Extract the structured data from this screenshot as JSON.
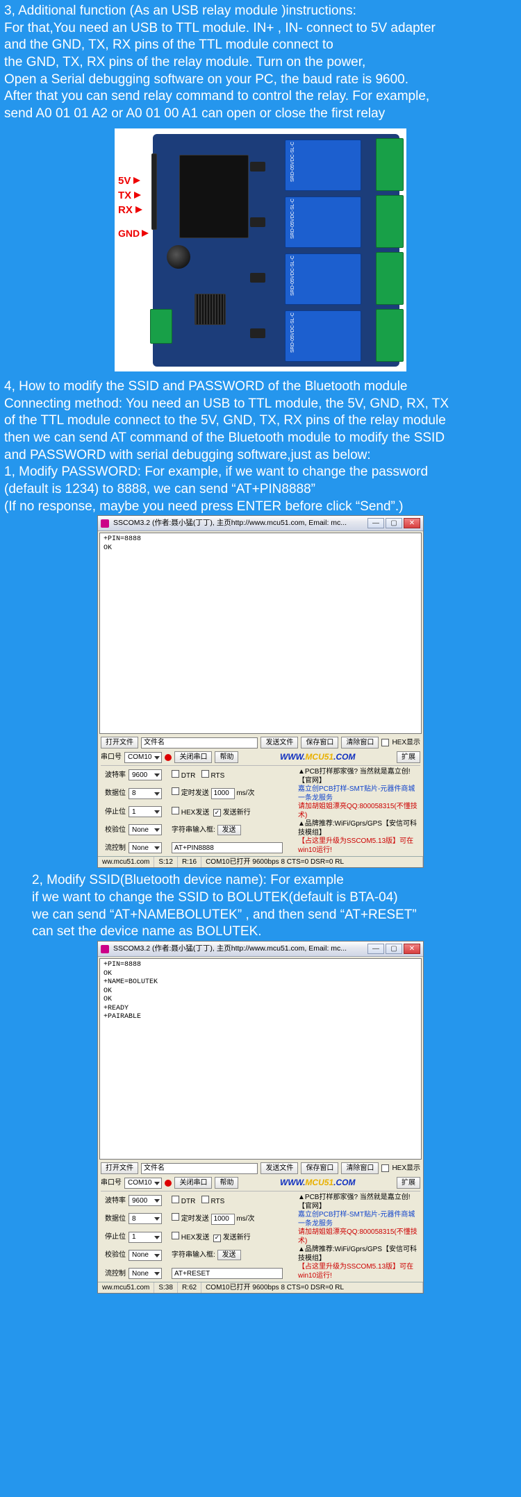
{
  "section3": {
    "title": "3, Additional function (As an USB relay module )instructions:",
    "l1": "For that,You need an USB to TTL module. IN+ , IN- connect to 5V adapter",
    "l2": "and the GND, TX, RX pins of the TTL module connect to",
    "l3": "the GND, TX, RX pins of the relay module. Turn on the power,",
    "l4": "Open a Serial debugging software on your PC, the baud rate is 9600.",
    "l5": "After that you can send relay command to control the relay. For example,",
    "l6": "send A0 01 01 A2 or A0 01 00 A1 can open or close the first relay"
  },
  "board": {
    "pin5v": "5V",
    "pinTx": "TX",
    "pinRx": "RX",
    "pinGnd": "GND",
    "relayText": "SRD-05VDC-SL-C"
  },
  "section4": {
    "title": "4, How to modify the SSID and PASSWORD of the Bluetooth module",
    "l1": "Connecting method: You need an USB to TTL module, the 5V, GND, RX, TX",
    "l2": "of the TTL module connect to the 5V, GND, TX, RX pins of the relay module",
    "l3": "then we can send AT command of the Bluetooth module to modify the SSID",
    "l4": "and PASSWORD with serial debugging software,just as below:",
    "l5": "1, Modify PASSWORD: For example, if we want to change the password",
    "l6": "(default is 1234) to 8888, we can send  “AT+PIN8888”",
    "l7": "(If no response, maybe you need press ENTER before click “Send”.)"
  },
  "sscom1": {
    "title": "SSCOM3.2 (作者:聂小猛(丁丁), 主页http://www.mcu51.com,  Email: mc...",
    "output": "+PIN=8888\nOK",
    "openfile": "打开文件",
    "filename_lbl": "文件名",
    "sendfile": "发送文件",
    "savewin": "保存窗口",
    "clearwin": "清除窗口",
    "hexshow": "HEX显示",
    "port_lbl": "串口号",
    "port": "COM10",
    "closeport": "关闭串口",
    "help": "帮助",
    "url_www": "WWW.",
    "url_mcu": "MCU51",
    "url_com": ".COM",
    "expand": "扩展",
    "baud_lbl": "波特率",
    "baud": "9600",
    "dtr": "DTR",
    "rts": "RTS",
    "data_lbl": "数据位",
    "data": "8",
    "timed": "定时发送",
    "timed_val": "1000",
    "timed_unit": "ms/次",
    "stop_lbl": "停止位",
    "stop": "1",
    "hexsend": "HEX发送",
    "sendnew": "发送新行",
    "parity_lbl": "校验位",
    "parity": "None",
    "inputlbl": "字符串输入框:",
    "send": "发送",
    "flow_lbl": "流控制",
    "flow": "None",
    "input": "AT+PIN8888",
    "promo1": "▲PCB打样那家强? 当然就是嘉立创! 【官网】",
    "promo2": "嘉立创PCB打样-SMT贴片-元器件商城一条龙服务",
    "promo3": "请加胡姐姐漂亮QQ:800058315(不懂技术)",
    "promo4": "▲品牌推荐:WiFi/Gprs/GPS【安信可科技模组】",
    "promo5": "【占这里升级为SSCOM5.13版】可在win10运行!",
    "status_site": "ww.mcu51.com",
    "status_s": "S:12",
    "status_r": "R:16",
    "status_conn": "COM10已打开  9600bps  8 CTS=0 DSR=0 RL"
  },
  "mid": {
    "l1": "2, Modify SSID(Bluetooth device name): For example",
    "l2": "if we want to change the SSID to BOLUTEK(default is BTA-04)",
    "l3": "we can send “AT+NAMEBOLUTEK” , and then send  “AT+RESET”",
    "l4": "can set the device name as BOLUTEK."
  },
  "sscom2": {
    "output": "+PIN=8888\nOK\n+NAME=BOLUTEK\nOK\nOK\n+READY\n+PAIRABLE",
    "input": "AT+RESET",
    "status_s": "S:38",
    "status_r": "R:62"
  }
}
